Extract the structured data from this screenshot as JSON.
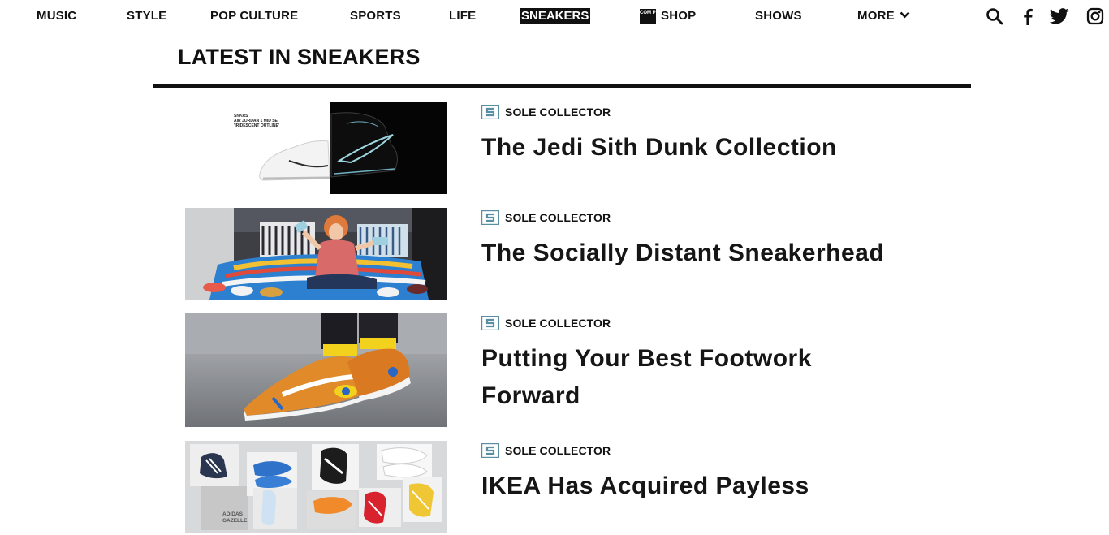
{
  "nav": {
    "items": [
      {
        "label": "MUSIC"
      },
      {
        "label": "STYLE"
      },
      {
        "label": "POP CULTURE"
      },
      {
        "label": "SPORTS"
      },
      {
        "label": "LIFE"
      },
      {
        "label": "SNEAKERS",
        "active": true
      },
      {
        "label": "SHOP",
        "logo_text": "COM PLEX"
      },
      {
        "label": "SHOWS"
      },
      {
        "label": "MORE"
      }
    ],
    "icons": [
      "search-icon",
      "facebook-icon",
      "twitter-icon",
      "instagram-icon"
    ]
  },
  "section": {
    "title": "LATEST IN SNEAKERS"
  },
  "articles": [
    {
      "source": "SOLE COLLECTOR",
      "title": "The Jedi Sith Dunk Collection",
      "thumb_caption": [
        "SNKRS",
        "AIR JORDAN 1 MID SE",
        "'IRIDESCENT OUTLINE'"
      ]
    },
    {
      "source": "SOLE COLLECTOR",
      "title": "The Socially Distant Sneakerhead"
    },
    {
      "source": "SOLE COLLECTOR",
      "title": "Putting Your Best Footwork Forward"
    },
    {
      "source": "SOLE COLLECTOR",
      "title": "IKEA Has Acquired Payless",
      "thumb_caption": [
        "ADIDAS",
        "GAZELLE"
      ]
    }
  ],
  "colors": {
    "text": "#111111",
    "active_bg": "#111111",
    "source_logo": "#5a8fa3"
  }
}
